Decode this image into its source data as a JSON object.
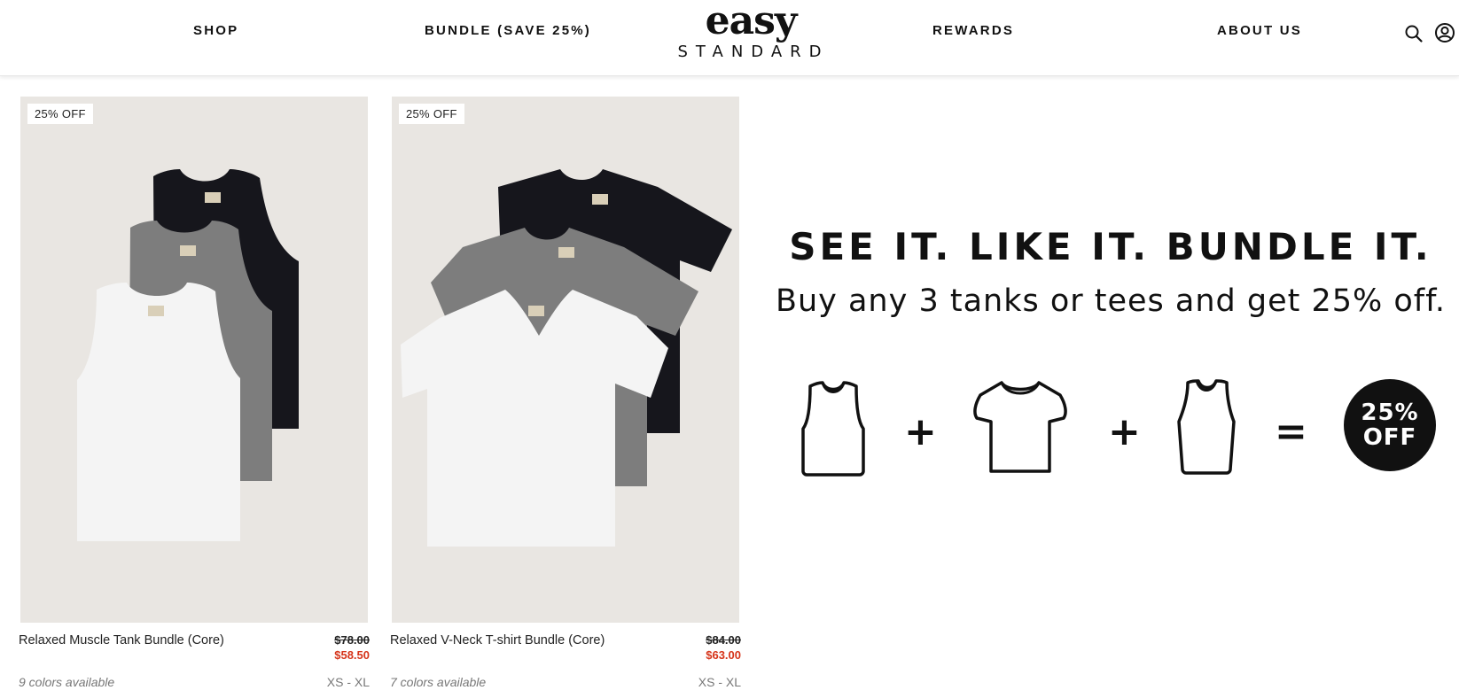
{
  "header": {
    "nav": [
      "SHOP",
      "BUNDLE (SAVE 25%)",
      "REWARDS",
      "ABOUT US"
    ],
    "logo_top": "easy",
    "logo_bottom": "STANDARD",
    "icons": [
      "search-icon",
      "account-icon"
    ]
  },
  "products": [
    {
      "badge": "25% OFF",
      "name": "Relaxed Muscle Tank Bundle (Core)",
      "original_price": "$78.00",
      "sale_price": "$58.50",
      "colors": "9 colors available",
      "sizes": "XS - XL"
    },
    {
      "badge": "25% OFF",
      "name": "Relaxed V-Neck T-shirt Bundle (Core)",
      "original_price": "$84.00",
      "sale_price": "$63.00",
      "colors": "7 colors available",
      "sizes": "XS - XL"
    }
  ],
  "promo": {
    "title": "SEE IT. LIKE IT. BUNDLE IT.",
    "subtitle": "Buy any 3 tanks or tees and get 25% off.",
    "plus": "+",
    "equals": "=",
    "badge_line1": "25%",
    "badge_line2": "OFF"
  },
  "colors": {
    "sale_red": "#d6351b",
    "image_bg": "#e9e6e2",
    "dark_shirt": "#16161c",
    "grey_shirt": "#7d7d7d",
    "white_shirt": "#f4f4f4"
  }
}
